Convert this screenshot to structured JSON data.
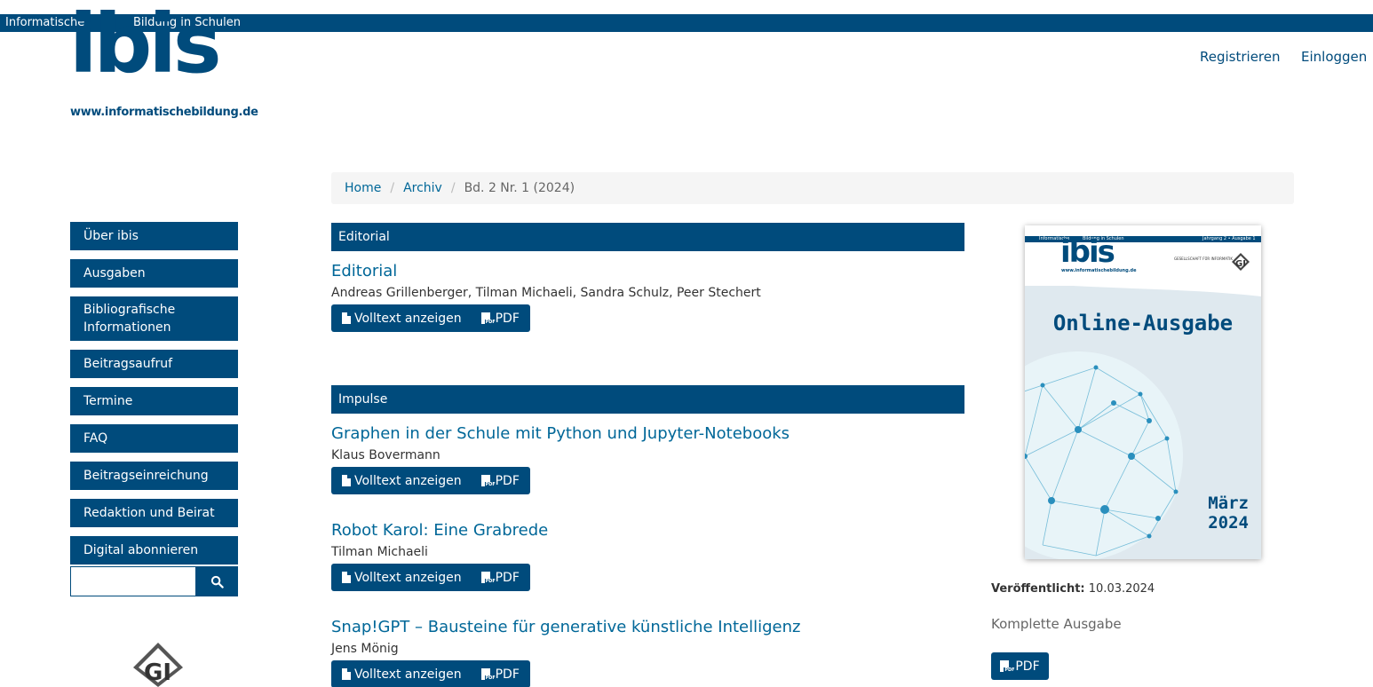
{
  "header": {
    "bar_left": "Informatische",
    "bar_right": "Bildung in Schulen",
    "logo_word": "ibis",
    "logo_url": "www.informatischebildung.de",
    "register": "Registrieren",
    "login": "Einloggen"
  },
  "breadcrumb": {
    "home": "Home",
    "archive": "Archiv",
    "current": "Bd. 2 Nr. 1 (2024)",
    "separator": "/"
  },
  "sidebar": {
    "items": [
      {
        "label": "Über ibis"
      },
      {
        "label": "Ausgaben"
      },
      {
        "label": "Bibliografische Informationen"
      },
      {
        "label": "Beitragsaufruf"
      },
      {
        "label": "Termine"
      },
      {
        "label": "FAQ"
      },
      {
        "label": "Beitragseinreichung"
      },
      {
        "label": "Redaktion und Beirat"
      },
      {
        "label": "Digital abonnieren"
      }
    ],
    "search_placeholder": ""
  },
  "sections": [
    {
      "title": "Editorial",
      "articles": [
        {
          "title": "Editorial",
          "authors": "Andreas Grillenberger, Tilman Michaeli, Sandra Schulz, Peer Stechert"
        }
      ]
    },
    {
      "title": "Impulse",
      "articles": [
        {
          "title": "Graphen in der Schule mit Python und Jupyter-Notebooks",
          "authors": "Klaus Bovermann"
        },
        {
          "title": "Robot Karol: Eine Grabrede",
          "authors": "Tilman Michaeli"
        },
        {
          "title": "Snap!GPT – Bausteine für generative künstliche Intelligenz",
          "authors": "Jens Mönig"
        }
      ]
    }
  ],
  "article_buttons": {
    "fulltext": "Volltext anzeigen",
    "pdf": "PDF"
  },
  "issue": {
    "cover_bar_left": "Informatische",
    "cover_bar_mid": "Bildung in Schulen",
    "cover_bar_right": "Jahrgang 2 • Ausgabe 1",
    "cover_logo": "ibis",
    "cover_url": "www.informatischebildung.de",
    "cover_gi_text": "GESELLSCHAFT FÜR INFORMATIK",
    "cover_title": "Online-Ausgabe",
    "cover_month": "März",
    "cover_year": "2024",
    "published_label": "Veröffentlicht:",
    "published_date": "10.03.2024",
    "complete_issue": "Komplette Ausgabe",
    "pdf": "PDF"
  },
  "colors": {
    "brand": "#004b7c",
    "link": "#006798"
  }
}
